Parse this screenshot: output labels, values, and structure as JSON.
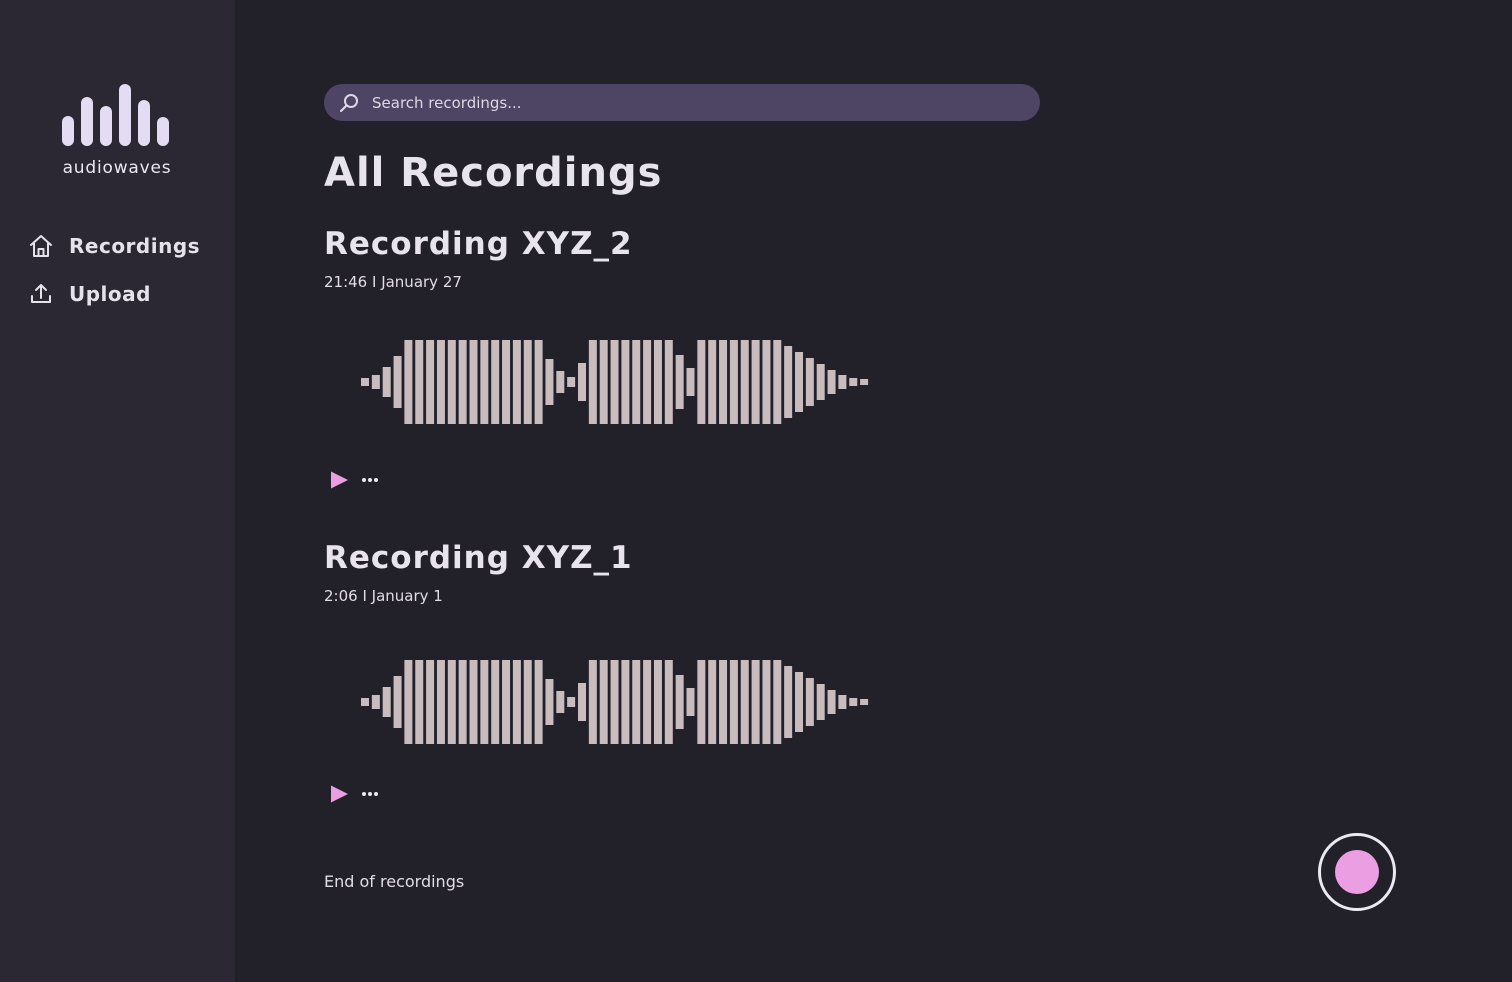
{
  "app": {
    "name": "audiowaves"
  },
  "sidebar": {
    "items": [
      {
        "label": "Recordings",
        "icon": "home-icon"
      },
      {
        "label": "Upload",
        "icon": "upload-icon"
      }
    ]
  },
  "search": {
    "placeholder": "Search recordings...",
    "value": ""
  },
  "page": {
    "title": "All Recordings",
    "footer": "End of recordings"
  },
  "recordings": [
    {
      "title": "Recording XYZ_2",
      "meta": "21:46 I January 27"
    },
    {
      "title": "Recording XYZ_1",
      "meta": "2:06 I January 1"
    }
  ],
  "colors": {
    "background": "#222029",
    "sidebar": "#2b2833",
    "search": "#4d4563",
    "accent": "#eb9ee2",
    "waveform": "#c9bcbf"
  }
}
